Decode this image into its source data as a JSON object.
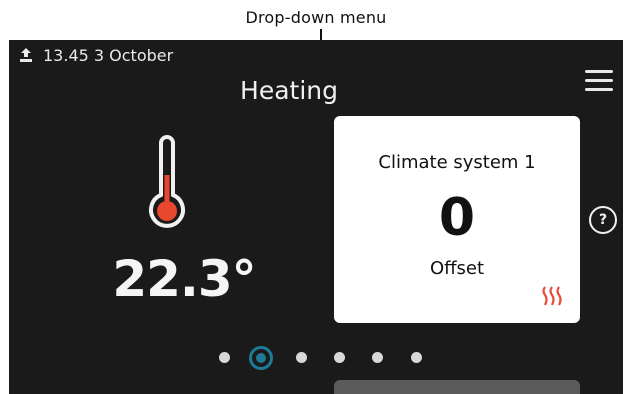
{
  "annotation": {
    "label": "Drop-down menu"
  },
  "status": {
    "datetime": "13.45 3 October",
    "icon": "upload-icon"
  },
  "header": {
    "title": "Heating",
    "menu_icon": "hamburger-menu-icon"
  },
  "temperature": {
    "value": "22.3°",
    "icon": "thermometer-icon"
  },
  "card": {
    "title": "Climate system 1",
    "value": "0",
    "label": "Offset",
    "icon": "heating-waves-icon"
  },
  "help": {
    "label": "?"
  },
  "pager": {
    "count": 6,
    "active_index": 1
  },
  "colors": {
    "background": "#1a1a1a",
    "accent": "#1e7a96",
    "thermo_red": "#e8472d",
    "heat_red": "#e84a3a"
  }
}
